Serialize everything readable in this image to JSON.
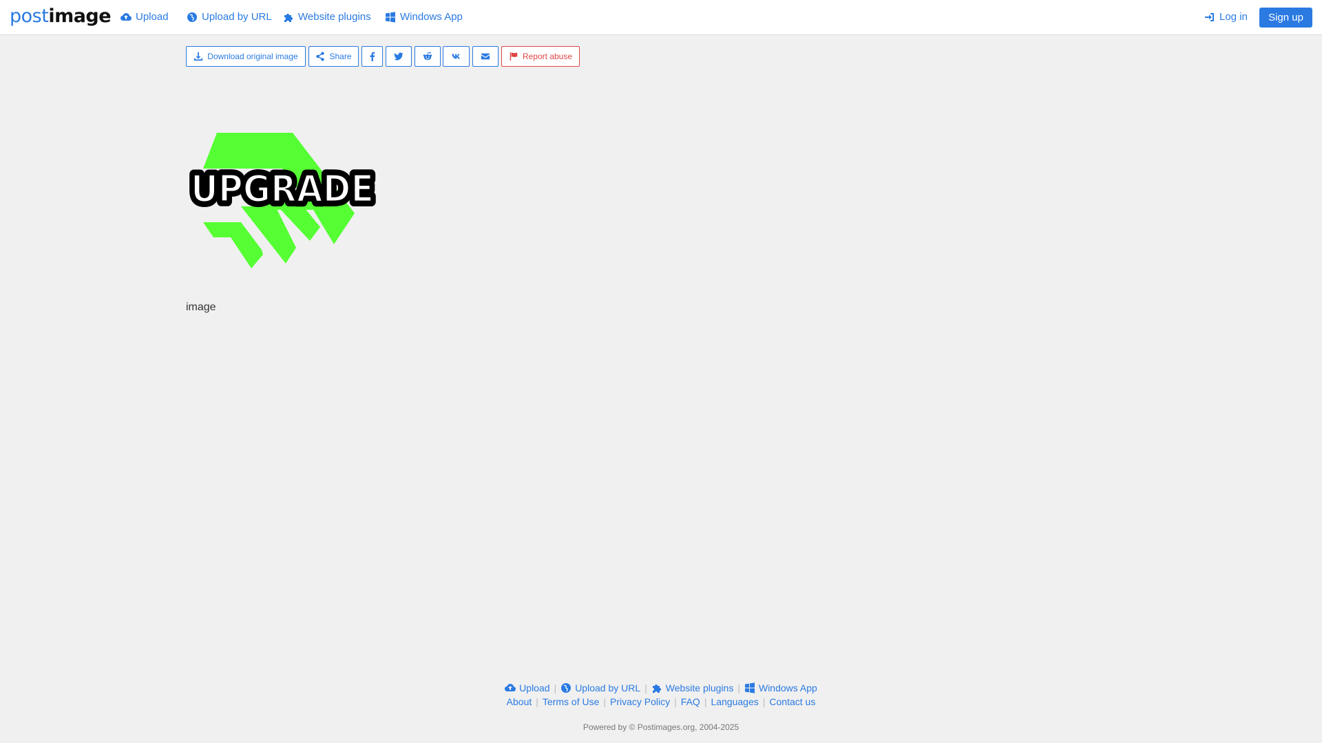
{
  "header": {
    "logo": {
      "part1": "post",
      "part2": "image"
    },
    "nav": [
      {
        "label": "Upload",
        "icon": "cloud-upload-icon"
      },
      {
        "label": "Upload by URL",
        "icon": "globe-icon"
      },
      {
        "label": "Website plugins",
        "icon": "puzzle-icon"
      },
      {
        "label": "Windows App",
        "icon": "windows-icon"
      }
    ],
    "login_label": "Log in",
    "signup_label": "Sign up"
  },
  "actions": {
    "download_label": "Download original image",
    "share_label": "Share",
    "social_icons": [
      "facebook-icon",
      "twitter-icon",
      "reddit-icon",
      "vk-icon",
      "envelope-icon"
    ],
    "report_label": "Report abuse"
  },
  "image": {
    "text": "UPGRADE",
    "caption": "image"
  },
  "footer": {
    "row1": [
      {
        "label": "Upload",
        "icon": "cloud-upload-icon"
      },
      {
        "label": "Upload by URL",
        "icon": "globe-icon"
      },
      {
        "label": "Website plugins",
        "icon": "puzzle-icon"
      },
      {
        "label": "Windows App",
        "icon": "windows-icon"
      }
    ],
    "row2": [
      "About",
      "Terms of Use",
      "Privacy Policy",
      "FAQ",
      "Languages",
      "Contact us"
    ],
    "powered": "Powered by © Postimages.org, 2004-2025"
  },
  "colors": {
    "accent": "#2a7ae2",
    "danger": "#e04545",
    "background": "#f0f0f0",
    "arrow_green": "#55ff33"
  }
}
